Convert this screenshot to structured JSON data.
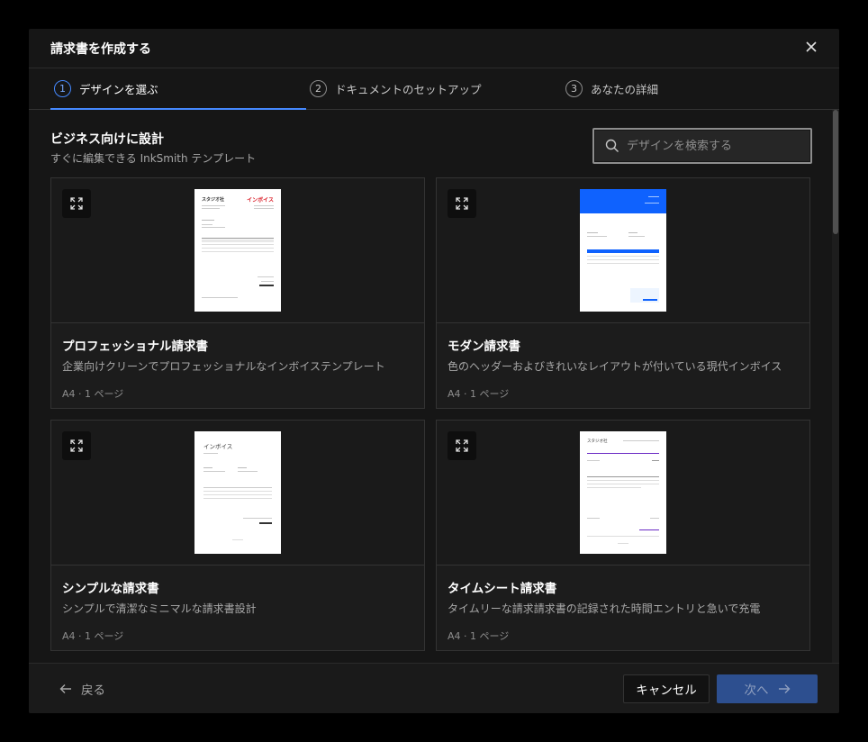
{
  "dialog": {
    "title": "請求書を作成する",
    "close_icon": "close-icon"
  },
  "steps": [
    {
      "number": "1",
      "label": "デザインを選ぶ",
      "active": true
    },
    {
      "number": "2",
      "label": "ドキュメントのセットアップ",
      "active": false
    },
    {
      "number": "3",
      "label": "あなたの詳細",
      "active": false
    }
  ],
  "section": {
    "title": "ビジネス向けに設計",
    "subtitle": "すぐに編集できる InkSmith テンプレート"
  },
  "search": {
    "placeholder": "デザインを検索する",
    "value": ""
  },
  "templates": [
    {
      "title": "プロフェッショナル請求書",
      "description": "企業向けクリーンでプロフェッショナルなインボイステンプレート",
      "meta": "A4 · 1 ページ",
      "thumb_title": "インボイス",
      "thumb_company": "スタジオ社"
    },
    {
      "title": "モダン請求書",
      "description": "色のヘッダーおよびきれいなレイアウトが付いている現代インボイス",
      "meta": "A4 · 1 ページ"
    },
    {
      "title": "シンプルな請求書",
      "description": "シンプルで清潔なミニマルな請求書設計",
      "meta": "A4 · 1 ページ",
      "thumb_title": "インボイス"
    },
    {
      "title": "タイムシート請求書",
      "description": "タイムリーな請求請求書の記録された時間エントリと急いで充電",
      "meta": "A4 · 1 ページ",
      "thumb_company": "スタジオ社"
    }
  ],
  "footer": {
    "back_label": "戻る",
    "cancel_label": "キャンセル",
    "next_label": "次へ"
  },
  "colors": {
    "accent": "#4589ff",
    "primary_button": "#2d4f8f",
    "modern_header": "#0f62fe",
    "professional_accent": "#da1e28",
    "timesheet_accent": "#6929c4"
  }
}
